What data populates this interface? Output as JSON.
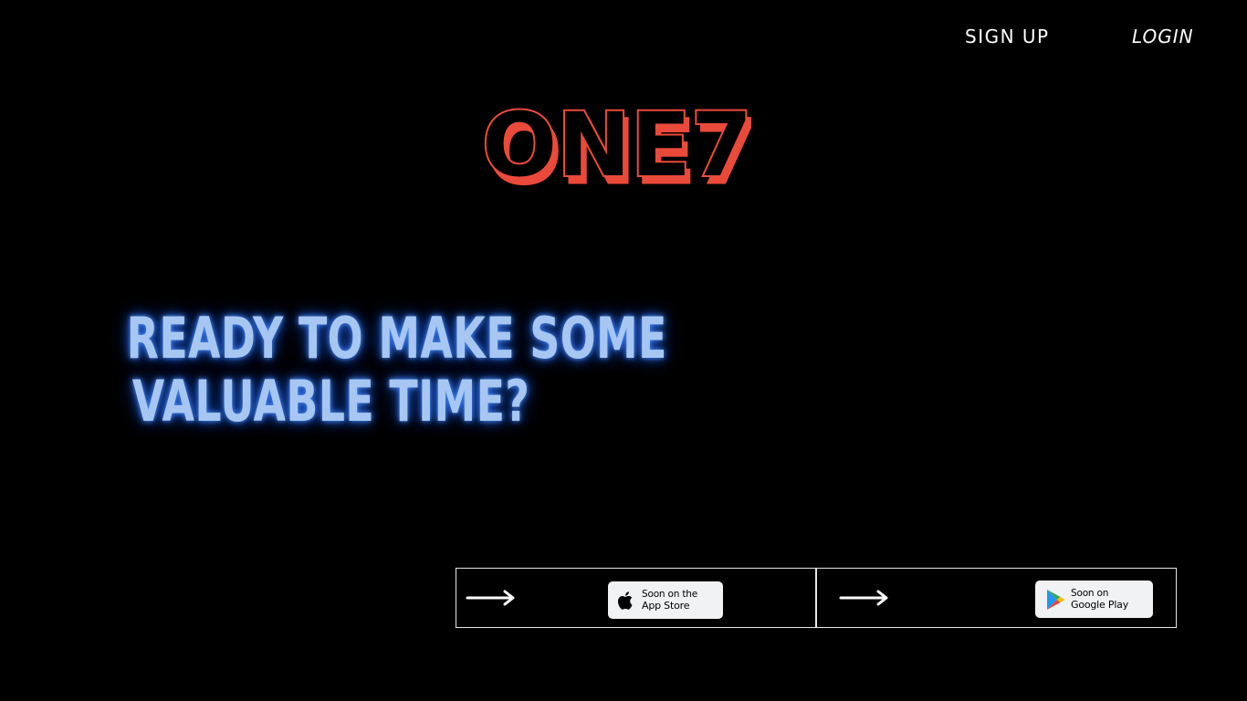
{
  "nav": {
    "signup_label": "SIGN UP",
    "login_label": "LOGIN"
  },
  "logo": {
    "text": "ONE7",
    "fill_color": "#ea4a3a"
  },
  "hero": {
    "line1": "READY TO MAKE SOME",
    "line2": "VALUABLE TIME?",
    "color": "#a7c7f2",
    "glow_color": "#2f7bff"
  },
  "stores": {
    "apple": {
      "line1": "Soon on the",
      "line2": "App Store",
      "icon": "apple-icon"
    },
    "google": {
      "line1": "Soon on",
      "line2": "Google Play",
      "icon": "google-play-icon"
    },
    "arrow_icon": "arrow-right-icon"
  }
}
